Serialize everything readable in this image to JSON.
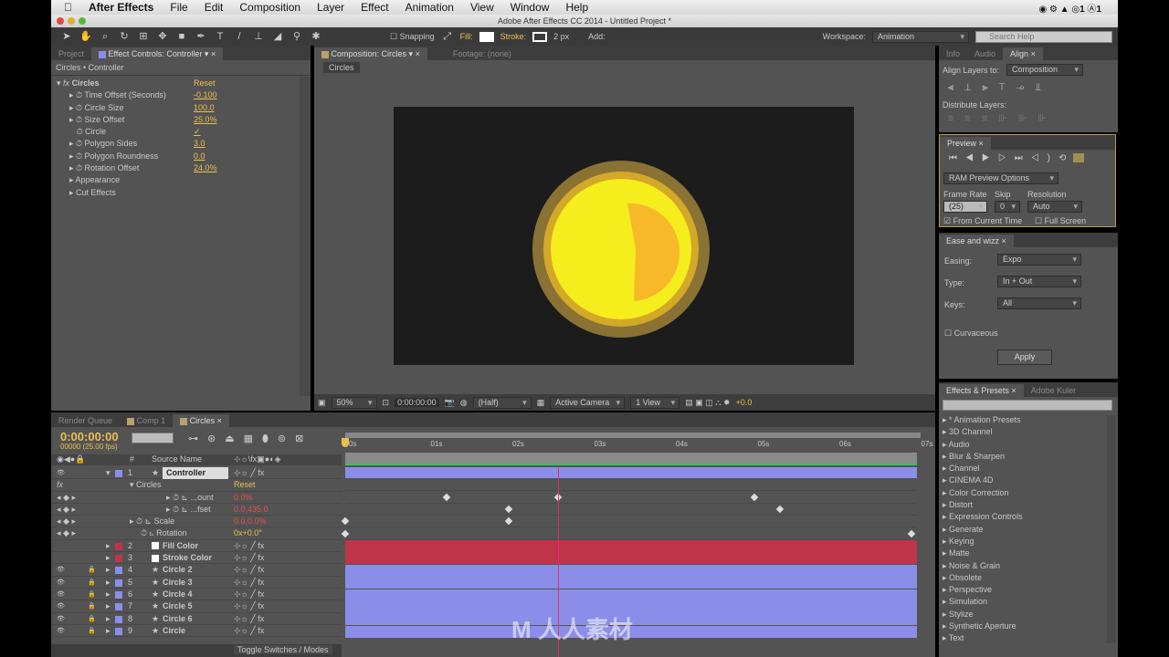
{
  "menubar": {
    "app": "After Effects",
    "items": [
      "File",
      "Edit",
      "Composition",
      "Layer",
      "Effect",
      "Animation",
      "View",
      "Window",
      "Help"
    ],
    "status_badges": [
      "1",
      "1"
    ]
  },
  "window_title": "Adobe After Effects CC 2014 - Untitled Project *",
  "toolbar": {
    "snapping": "Snapping",
    "fill": "Fill:",
    "stroke": "Stroke:",
    "stroke_width": "2 px",
    "add": "Add:",
    "workspace_label": "Workspace:",
    "workspace": "Animation",
    "search_placeholder": "Search Help"
  },
  "left_panel": {
    "tabs": [
      "Project",
      "Effect Controls: Controller"
    ],
    "breadcrumb": "Circles • Controller",
    "effect": "Circles",
    "reset": "Reset",
    "props": [
      {
        "name": "Time Offset (Seconds)",
        "value": "-0.100"
      },
      {
        "name": "Circle Size",
        "value": "100.0"
      },
      {
        "name": "Size Offset",
        "value": "25.0%"
      },
      {
        "name": "Circle",
        "value": "✓"
      },
      {
        "name": "Polygon Sides",
        "value": "3.0"
      },
      {
        "name": "Polygon Roundness",
        "value": "0.0"
      },
      {
        "name": "Rotation Offset",
        "value": "24.0%"
      }
    ],
    "groups": [
      "Appearance",
      "Cut Effects"
    ]
  },
  "comp_panel": {
    "tabs": [
      "Composition: Circles",
      "Footage: (none)"
    ],
    "subtab": "Circles",
    "zoom": "50%",
    "timecode": "0:00:00:00",
    "resolution": "(Half)",
    "camera": "Active Camera",
    "views": "1 View",
    "exposure": "+0.0",
    "colors": {
      "bg": "#1c1c1c",
      "outer": "#8a7234",
      "ring": "#d4a828",
      "inner": "#f5ee1c",
      "wedge": "#f7b82a"
    }
  },
  "align_panel": {
    "tabs": [
      "Info",
      "Audio",
      "Align"
    ],
    "align_to_label": "Align Layers to:",
    "align_to": "Composition",
    "distribute_label": "Distribute Layers:"
  },
  "preview_panel": {
    "tab": "Preview",
    "options": "RAM Preview Options",
    "frame_rate_label": "Frame Rate",
    "skip_label": "Skip",
    "resolution_label": "Resolution",
    "frame_rate": "(25)",
    "skip": "0",
    "resolution": "Auto",
    "from_current": "From Current Time",
    "full_screen": "Full Screen"
  },
  "ease_panel": {
    "tab": "Ease and wizz",
    "easing_label": "Easing:",
    "easing": "Expo",
    "type_label": "Type:",
    "type": "In + Out",
    "keys_label": "Keys:",
    "keys": "All",
    "curvaceous": "Curvaceous",
    "apply": "Apply"
  },
  "effects_panel": {
    "tabs": [
      "Effects & Presets",
      "Adobe Kuler"
    ],
    "items": [
      "* Animation Presets",
      "3D Channel",
      "Audio",
      "Blur & Sharpen",
      "Channel",
      "CINEMA 4D",
      "Color Correction",
      "Distort",
      "Expression Controls",
      "Generate",
      "Keying",
      "Matte",
      "Noise & Grain",
      "Obsolete",
      "Perspective",
      "Simulation",
      "Stylize",
      "Synthetic Aperture",
      "Text"
    ]
  },
  "timeline": {
    "tabs": [
      "Render Queue",
      "Comp 1",
      "Circles"
    ],
    "timecode": "0:00:00:00",
    "frames": "00000 (25.00 fps)",
    "source_name_header": "Source Name",
    "hash_header": "#",
    "toggle": "Toggle Switches / Modes",
    "ruler": [
      "0s",
      "01s",
      "02s",
      "03s",
      "04s",
      "05s",
      "06s",
      "07s"
    ],
    "playhead_seconds": 2.6,
    "effect_row": {
      "name": "Circles",
      "reset": "Reset"
    },
    "props": [
      {
        "name": "...ount",
        "value": "0.0%",
        "keys": [
          1.24,
          2.6,
          5.0
        ]
      },
      {
        "name": "...fset",
        "value": "0.0,435.0",
        "keys": [
          2.0,
          5.32
        ]
      },
      {
        "name": "Scale",
        "value": "0.0,0.0%",
        "keys": [
          0,
          2.0
        ]
      },
      {
        "name": "Rotation",
        "value": "0x+0.0°",
        "keys": [
          0,
          6.93
        ]
      }
    ],
    "layers": [
      {
        "num": "1",
        "name": "Controller",
        "color": "#8a8ee8"
      },
      {
        "num": "2",
        "name": "Fill Color",
        "color": "#c0344a"
      },
      {
        "num": "3",
        "name": "Stroke Color",
        "color": "#c0344a"
      },
      {
        "num": "4",
        "name": "Circle 2",
        "color": "#8a8ee8"
      },
      {
        "num": "5",
        "name": "Circle 3",
        "color": "#8a8ee8"
      },
      {
        "num": "6",
        "name": "Circle 4",
        "color": "#8a8ee8"
      },
      {
        "num": "7",
        "name": "Circle 5",
        "color": "#8a8ee8"
      },
      {
        "num": "8",
        "name": "Circle 6",
        "color": "#8a8ee8"
      },
      {
        "num": "9",
        "name": "Circle",
        "color": "#8a8ee8"
      }
    ]
  },
  "watermark": "人人素材"
}
